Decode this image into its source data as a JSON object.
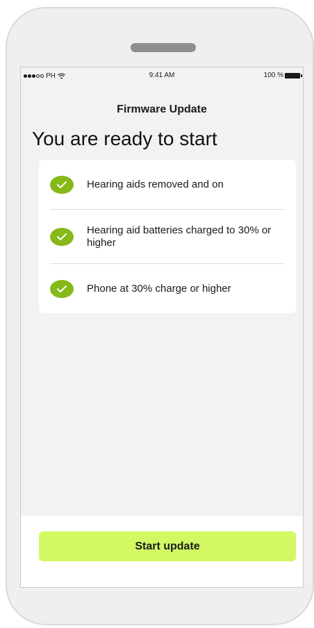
{
  "status_bar": {
    "carrier": "PH",
    "time": "9:41 AM",
    "battery": "100 %"
  },
  "header": {
    "title": "Firmware Update"
  },
  "main": {
    "heading": "You are ready to start",
    "checklist": [
      {
        "label": "Hearing aids removed and on",
        "checked": true,
        "icon": "check-circle-icon"
      },
      {
        "label": "Hearing aid batteries charged to 30% or higher",
        "checked": true,
        "icon": "check-circle-icon"
      },
      {
        "label": "Phone at 30% charge or higher",
        "checked": true,
        "icon": "check-circle-icon"
      }
    ]
  },
  "footer": {
    "start_label": "Start update"
  },
  "colors": {
    "accent": "#d2f864",
    "check": "#86b817",
    "background": "#f2f2f0",
    "card": "#ffffff"
  }
}
